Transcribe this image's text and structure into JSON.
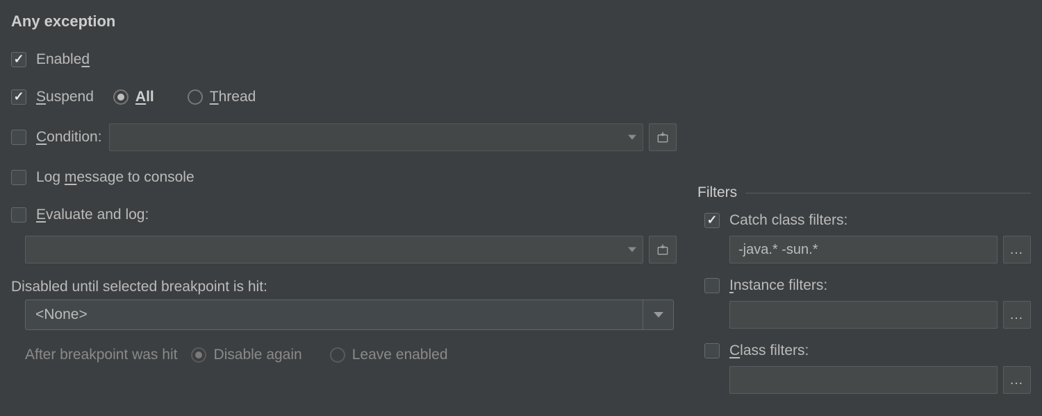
{
  "title": "Any exception",
  "enabled": {
    "label_pre": "Enable",
    "label_u": "d",
    "label_post": "",
    "checked": true
  },
  "suspend": {
    "label_u": "S",
    "label_post": "uspend",
    "checked": true,
    "all": {
      "label_u": "A",
      "label_post": "ll",
      "selected": true
    },
    "thread": {
      "label_u": "T",
      "label_post": "hread",
      "selected": false
    }
  },
  "condition": {
    "label_u": "C",
    "label_post": "ondition:",
    "checked": false,
    "value": ""
  },
  "log_console": {
    "label_pre": "Log ",
    "label_u": "m",
    "label_post": "essage to console",
    "checked": false
  },
  "evaluate": {
    "label_u": "E",
    "label_post": "valuate and log:",
    "checked": false,
    "value": ""
  },
  "disabled_until": {
    "label": "Disabled until selected breakpoint is hit:",
    "selected": "<None>",
    "after_label": "After breakpoint was hit",
    "disable_again": {
      "label": "Disable again",
      "selected": true
    },
    "leave_enabled": {
      "label": "Leave enabled",
      "selected": false
    }
  },
  "filters": {
    "heading": "Filters",
    "catch": {
      "label": "Catch class filters:",
      "checked": true,
      "value": "-java.* -sun.*"
    },
    "instance": {
      "label_u": "I",
      "label_post": "nstance filters:",
      "checked": false,
      "value": ""
    },
    "class": {
      "label_u": "C",
      "label_post": "lass filters:",
      "checked": false,
      "value": ""
    }
  }
}
